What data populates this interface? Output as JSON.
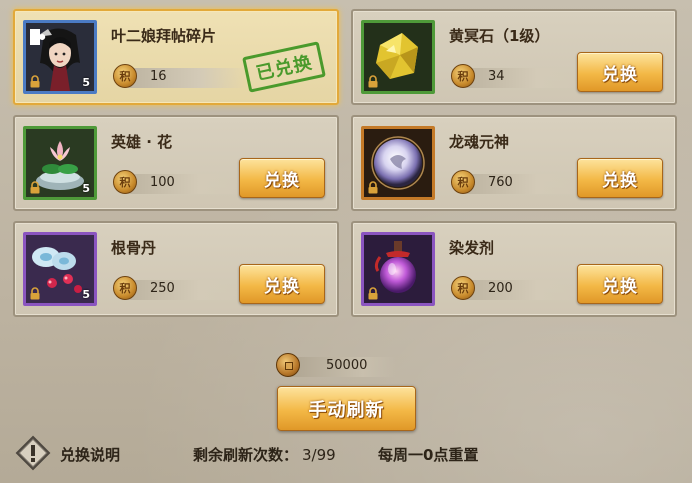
{
  "items": [
    {
      "name": "叶二娘拜帖碎片",
      "price": "16",
      "count": "5",
      "border": "blue",
      "status": "已兑换",
      "selected": true,
      "icon": "character-portrait-icon"
    },
    {
      "name": "黄冥石（1级）",
      "price": "34",
      "count": "",
      "border": "green",
      "button": "兑换",
      "icon": "gold-ore-icon"
    },
    {
      "name": "英雄 · 花",
      "price": "100",
      "count": "5",
      "border": "green",
      "button": "兑换",
      "icon": "lotus-flower-icon"
    },
    {
      "name": "龙魂元神",
      "price": "760",
      "count": "",
      "border": "orange",
      "button": "兑换",
      "icon": "dragon-soul-orb-icon"
    },
    {
      "name": "根骨丹",
      "price": "250",
      "count": "5",
      "border": "purple",
      "button": "兑换",
      "icon": "pill-icon"
    },
    {
      "name": "染发剂",
      "price": "200",
      "count": "",
      "border": "purple",
      "button": "兑换",
      "icon": "potion-bottle-icon"
    }
  ],
  "coin_label": "积",
  "currency": {
    "value": "50000",
    "icon": "copper-coin-icon"
  },
  "refresh_button": "手动刷新",
  "footer": {
    "explain_label": "兑换说明",
    "remaining_label": "剩余刷新次数：",
    "remaining_value": "3/99",
    "reset_note": "每周一0点重置"
  },
  "colors": {
    "accent": "#f3b846",
    "selected_border": "#e2a93a",
    "stamp": "#4a9a2c"
  }
}
